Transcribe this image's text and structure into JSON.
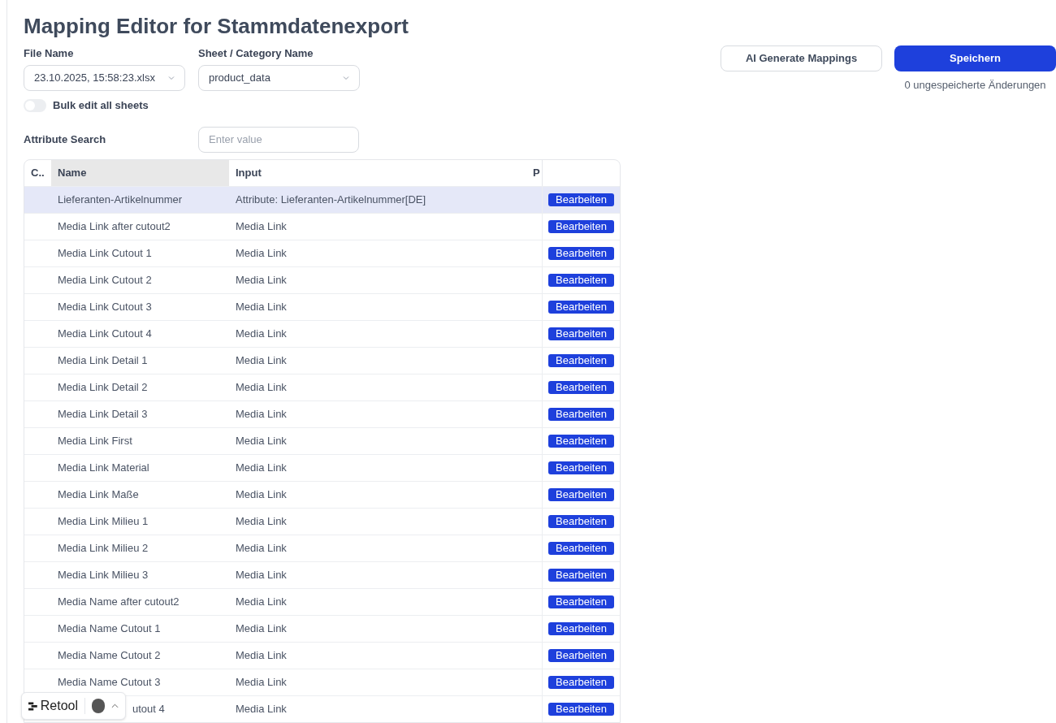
{
  "title": "Mapping Editor for Stammdatenexport",
  "file_name": {
    "label": "File Name",
    "value": "23.10.2025, 15:58:23.xlsx"
  },
  "sheet": {
    "label": "Sheet / Category Name",
    "value": "product_data"
  },
  "bulk_edit": {
    "label": "Bulk edit all sheets",
    "on": false
  },
  "attribute_search": {
    "label": "Attribute Search",
    "placeholder": "Enter value"
  },
  "buttons": {
    "ai_generate": "AI Generate Mappings",
    "save": "Speichern",
    "unsaved": "0 ungespeicherte Änderungen"
  },
  "table": {
    "columns": [
      {
        "label": "C..",
        "sorted": false
      },
      {
        "label": "Name",
        "sorted": true
      },
      {
        "label": "Input",
        "sorted": false
      },
      {
        "label": "P",
        "sorted": false
      }
    ],
    "rows": [
      {
        "name": "Lieferanten-Artikelnummer",
        "input": "Attribute: Lieferanten-Artikelnummer[DE]",
        "action": "Bearbeiten",
        "selected": true
      },
      {
        "name": "Media Link after cutout2",
        "input": "Media Link",
        "action": "Bearbeiten",
        "selected": false
      },
      {
        "name": "Media Link Cutout 1",
        "input": "Media Link",
        "action": "Bearbeiten",
        "selected": false
      },
      {
        "name": "Media Link Cutout 2",
        "input": "Media Link",
        "action": "Bearbeiten",
        "selected": false
      },
      {
        "name": "Media Link Cutout 3",
        "input": "Media Link",
        "action": "Bearbeiten",
        "selected": false
      },
      {
        "name": "Media Link Cutout 4",
        "input": "Media Link",
        "action": "Bearbeiten",
        "selected": false
      },
      {
        "name": "Media Link Detail 1",
        "input": "Media Link",
        "action": "Bearbeiten",
        "selected": false
      },
      {
        "name": "Media Link Detail 2",
        "input": "Media Link",
        "action": "Bearbeiten",
        "selected": false
      },
      {
        "name": "Media Link Detail 3",
        "input": "Media Link",
        "action": "Bearbeiten",
        "selected": false
      },
      {
        "name": "Media Link First",
        "input": "Media Link",
        "action": "Bearbeiten",
        "selected": false
      },
      {
        "name": "Media Link Material",
        "input": "Media Link",
        "action": "Bearbeiten",
        "selected": false
      },
      {
        "name": "Media Link Maße",
        "input": "Media Link",
        "action": "Bearbeiten",
        "selected": false
      },
      {
        "name": "Media Link Milieu 1",
        "input": "Media Link",
        "action": "Bearbeiten",
        "selected": false
      },
      {
        "name": "Media Link Milieu 2",
        "input": "Media Link",
        "action": "Bearbeiten",
        "selected": false
      },
      {
        "name": "Media Link Milieu 3",
        "input": "Media Link",
        "action": "Bearbeiten",
        "selected": false
      },
      {
        "name": "Media Name after cutout2",
        "input": "Media Link",
        "action": "Bearbeiten",
        "selected": false
      },
      {
        "name": "Media Name Cutout 1",
        "input": "Media Link",
        "action": "Bearbeiten",
        "selected": false
      },
      {
        "name": "Media Name Cutout 2",
        "input": "Media Link",
        "action": "Bearbeiten",
        "selected": false
      },
      {
        "name": "Media Name Cutout 3",
        "input": "Media Link",
        "action": "Bearbeiten",
        "selected": false
      },
      {
        "name": "utout 4",
        "input": "Media Link",
        "action": "Bearbeiten",
        "selected": false,
        "covered": true
      }
    ]
  },
  "badge": {
    "brand": "Retool"
  }
}
